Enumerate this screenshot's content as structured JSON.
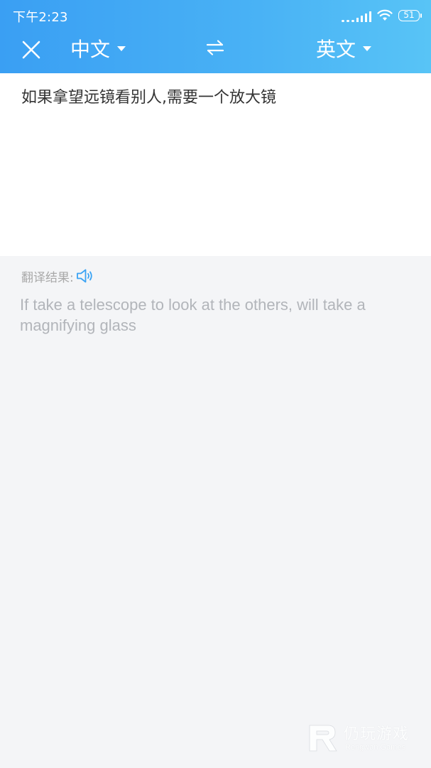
{
  "status_bar": {
    "time": "下午2:23",
    "battery": "51"
  },
  "toolbar": {
    "close_icon": "close-icon",
    "source_language": "中文",
    "target_language": "英文",
    "swap_icon": "swap-arrows-icon"
  },
  "input": {
    "source_text": "如果拿望远镜看别人,需要一个放大镜"
  },
  "result": {
    "label": "翻译结果:",
    "speaker_icon": "speaker-icon",
    "translated_text": "If take a telescope to look at the others, will take a magnifying glass"
  },
  "watermark": {
    "title": "仍玩游戏",
    "subtitle": "Rengwan Games"
  },
  "colors": {
    "header_start": "#3a9ff3",
    "header_end": "#58c4f6",
    "background": "#f4f5f7",
    "input_background": "#ffffff",
    "speaker_accent": "#3aa3f4"
  }
}
